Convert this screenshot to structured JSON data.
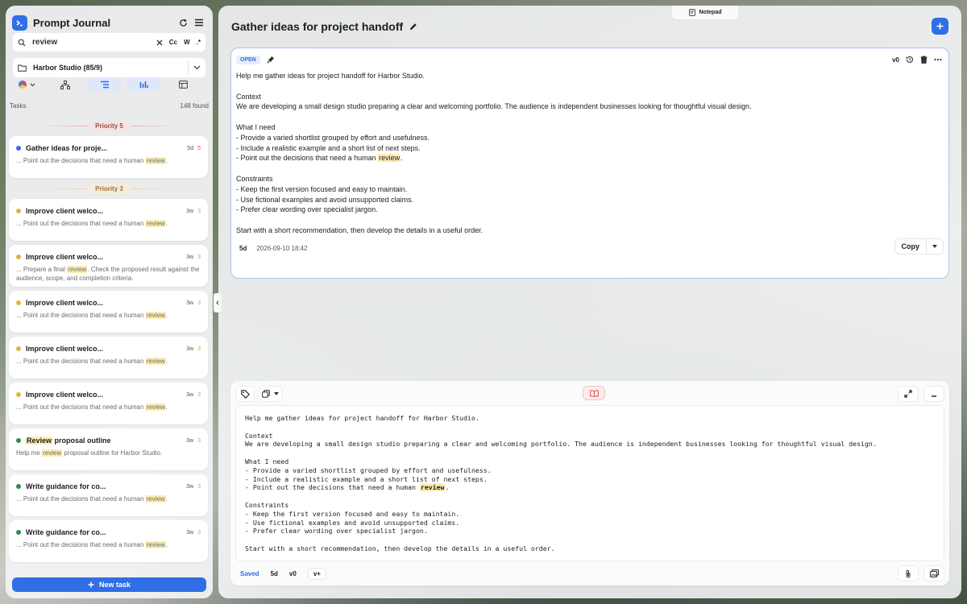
{
  "app": {
    "title": "Prompt Journal"
  },
  "search": {
    "value": "review",
    "opt_case": "Cc",
    "opt_word": "W",
    "opt_regex": ".*"
  },
  "folder": {
    "name": "Harbor Studio (85/9)"
  },
  "tasks": {
    "label": "Tasks",
    "found": "148 found"
  },
  "groups": [
    {
      "label": "Priority 5",
      "color": "#e24b4b",
      "items": [
        {
          "title": "Gather ideas for proje...",
          "age": "5d",
          "prio": "5",
          "dot": "#2f6ee5",
          "pre": "... Point out the decisions that need a human ",
          "hl": "review",
          "post": "."
        }
      ]
    },
    {
      "label": "Priority 3",
      "color": "#d9a441",
      "items": [
        {
          "title": "Improve client welco...",
          "age": "3w",
          "prio": "3",
          "dot": "#e3b341",
          "pre": "... Point out the decisions that need a human ",
          "hl": "review",
          "post": "."
        },
        {
          "title": "Improve client welco...",
          "age": "3w",
          "prio": "3",
          "dot": "#e3b341",
          "pre": "... Prepare a final ",
          "hl": "review",
          "post": ". Check the proposed result against the audience, scope, and completion criteria."
        },
        {
          "title": "Improve client welco...",
          "age": "3w",
          "prio": "3",
          "dot": "#e3b341",
          "pre": "... Point out the decisions that need a human ",
          "hl": "review",
          "post": "."
        },
        {
          "title": "Improve client welco...",
          "age": "3w",
          "prio": "3",
          "dot": "#e3b341",
          "pre": "... Point out the decisions that need a human ",
          "hl": "review",
          "post": "."
        },
        {
          "title": "Improve client welco...",
          "age": "3w",
          "prio": "3",
          "dot": "#e3b341",
          "pre": "... Point out the decisions that need a human ",
          "hl": "review",
          "post": "."
        },
        {
          "title_hl": "Review",
          "title": " proposal outline",
          "age": "3w",
          "prio": "3",
          "dot": "#2e8b4e",
          "pre": "Help me ",
          "hl": "review",
          "post": " proposal outline for Harbor Studio."
        },
        {
          "title": "Write guidance for co...",
          "age": "3w",
          "prio": "3",
          "dot": "#2e8b4e",
          "pre": "... Point out the decisions that need a human ",
          "hl": "review",
          "post": "."
        },
        {
          "title": "Write guidance for co...",
          "age": "3w",
          "prio": "3",
          "dot": "#2e8b4e",
          "pre": "... Point out the decisions that need a human ",
          "hl": "review",
          "post": "."
        }
      ]
    }
  ],
  "new_task_label": "New task",
  "notepad": {
    "label": "Notepad"
  },
  "main": {
    "title": "Gather ideas for project handoff",
    "status": "OPEN",
    "version": "v0",
    "body_before": "Help me gather ideas for project handoff for Harbor Studio.\n\nContext\nWe are developing a small design studio preparing a clear and welcoming portfolio. The audience is independent businesses looking for thoughtful visual design.\n\nWhat I need\n- Provide a varied shortlist grouped by effort and usefulness.\n- Include a realistic example and a short list of next steps.\n- Point out the decisions that need a human ",
    "body_hl": "review",
    "body_after": ".\n\nConstraints\n- Keep the first version focused and easy to maintain.\n- Use fictional examples and avoid unsupported claims.\n- Prefer clear wording over specialist jargon.\n\nStart with a short recommendation, then develop the details in a useful order.",
    "age": "5d",
    "timestamp": "2026-09-10 18:42",
    "copy_label": "Copy"
  },
  "editor": {
    "saved": "Saved",
    "age": "5d",
    "version": "v0",
    "vplus": "v+"
  },
  "colors": {
    "accent": "#2f6ee5",
    "highlight": "#fbeeb2"
  }
}
